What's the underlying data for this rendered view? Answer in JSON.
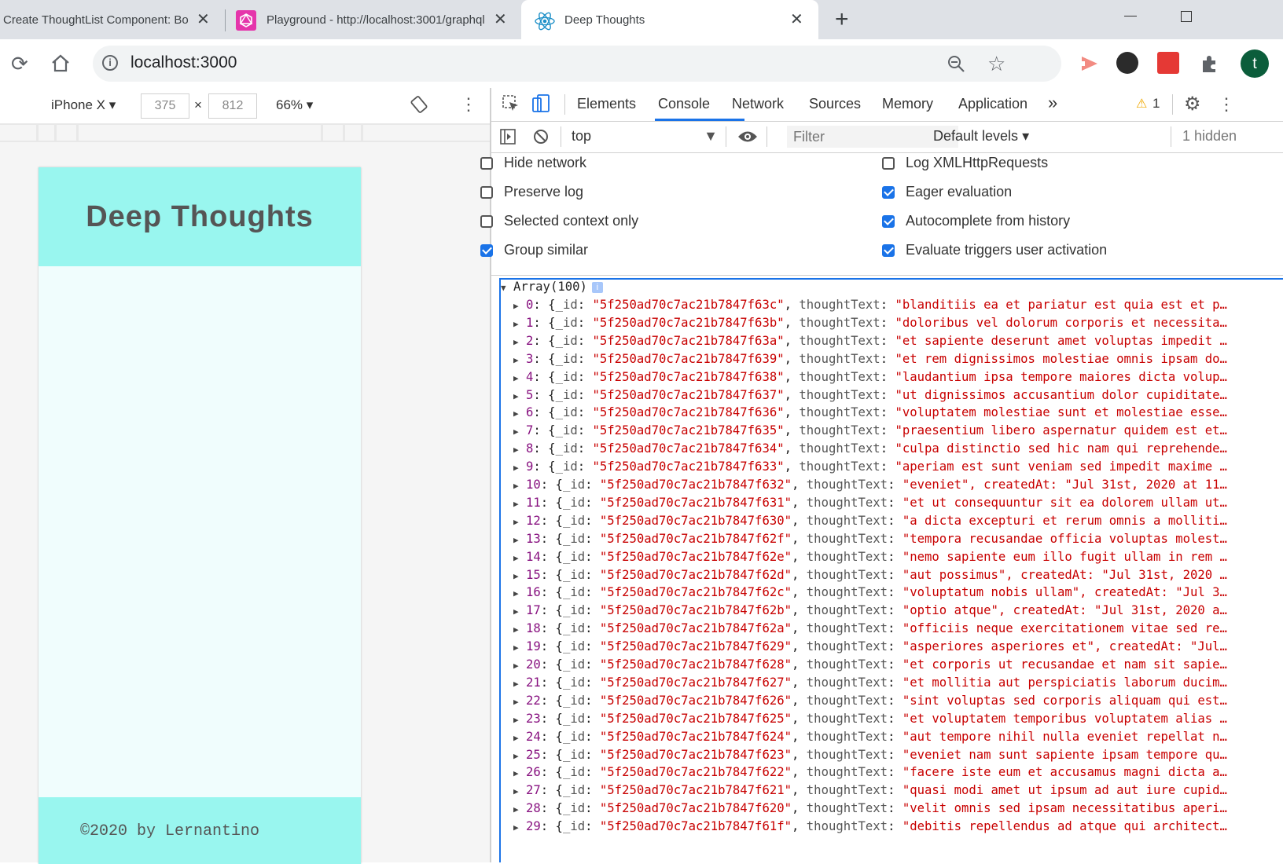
{
  "browser": {
    "tabs": [
      {
        "title": "Create ThoughtList Component: Boot",
        "favicon": "page-icon"
      },
      {
        "title": "Playground - http://localhost:3001/graphql",
        "favicon": "graphql-icon"
      },
      {
        "title": "Deep Thoughts",
        "favicon": "react-icon"
      }
    ],
    "address": "localhost:3000",
    "profile_initial": "t"
  },
  "device_toolbar": {
    "device": "iPhone X",
    "width": "375",
    "height": "812",
    "times": "×",
    "zoom": "66%"
  },
  "app": {
    "title": "Deep Thoughts",
    "footer": "©2020 by Lernantino",
    "header_color": "#99f6ef"
  },
  "devtools": {
    "tabs": [
      "Elements",
      "Console",
      "Network",
      "Sources",
      "Memory",
      "Application"
    ],
    "active_tab": "Console",
    "more": "»",
    "warnings": "1",
    "context": "top",
    "filter_placeholder": "Filter",
    "levels": "Default levels",
    "hidden": "1 hidden",
    "settings": {
      "left": [
        {
          "label": "Hide network",
          "checked": false
        },
        {
          "label": "Preserve log",
          "checked": false
        },
        {
          "label": "Selected context only",
          "checked": false
        },
        {
          "label": "Group similar",
          "checked": true
        }
      ],
      "right": [
        {
          "label": "Log XMLHttpRequests",
          "checked": false
        },
        {
          "label": "Eager evaluation",
          "checked": true
        },
        {
          "label": "Autocomplete from history",
          "checked": true
        },
        {
          "label": "Evaluate triggers user activation",
          "checked": true
        }
      ]
    },
    "accent": "#1a73e8"
  },
  "console": {
    "array_label": "Array(100)",
    "info_badge": "i",
    "rows": [
      {
        "idx": "0",
        "id": "5f250ad70c7ac21b7847f63c",
        "text": "\"blanditiis ea et pariatur est quia est et p…"
      },
      {
        "idx": "1",
        "id": "5f250ad70c7ac21b7847f63b",
        "text": "\"doloribus vel dolorum corporis et necessita…"
      },
      {
        "idx": "2",
        "id": "5f250ad70c7ac21b7847f63a",
        "text": "\"et sapiente deserunt amet voluptas impedit …"
      },
      {
        "idx": "3",
        "id": "5f250ad70c7ac21b7847f639",
        "text": "\"et rem dignissimos molestiae omnis ipsam do…"
      },
      {
        "idx": "4",
        "id": "5f250ad70c7ac21b7847f638",
        "text": "\"laudantium ipsa tempore maiores dicta volup…"
      },
      {
        "idx": "5",
        "id": "5f250ad70c7ac21b7847f637",
        "text": "\"ut dignissimos accusantium dolor cupiditate…"
      },
      {
        "idx": "6",
        "id": "5f250ad70c7ac21b7847f636",
        "text": "\"voluptatem molestiae sunt et molestiae esse…"
      },
      {
        "idx": "7",
        "id": "5f250ad70c7ac21b7847f635",
        "text": "\"praesentium libero aspernatur quidem est et…"
      },
      {
        "idx": "8",
        "id": "5f250ad70c7ac21b7847f634",
        "text": "\"culpa distinctio sed hic nam qui reprehende…"
      },
      {
        "idx": "9",
        "id": "5f250ad70c7ac21b7847f633",
        "text": "\"aperiam est sunt veniam sed impedit maxime …"
      },
      {
        "idx": "10",
        "id": "5f250ad70c7ac21b7847f632",
        "text": "\"eveniet\", createdAt: \"Jul 31st, 2020 at 11…"
      },
      {
        "idx": "11",
        "id": "5f250ad70c7ac21b7847f631",
        "text": "\"et ut consequuntur sit ea dolorem ullam ut…"
      },
      {
        "idx": "12",
        "id": "5f250ad70c7ac21b7847f630",
        "text": "\"a dicta excepturi et rerum omnis a molliti…"
      },
      {
        "idx": "13",
        "id": "5f250ad70c7ac21b7847f62f",
        "text": "\"tempora recusandae officia voluptas molest…"
      },
      {
        "idx": "14",
        "id": "5f250ad70c7ac21b7847f62e",
        "text": "\"nemo sapiente eum illo fugit ullam in rem …"
      },
      {
        "idx": "15",
        "id": "5f250ad70c7ac21b7847f62d",
        "text": "\"aut possimus\", createdAt: \"Jul 31st, 2020 …"
      },
      {
        "idx": "16",
        "id": "5f250ad70c7ac21b7847f62c",
        "text": "\"voluptatum nobis ullam\", createdAt: \"Jul 3…"
      },
      {
        "idx": "17",
        "id": "5f250ad70c7ac21b7847f62b",
        "text": "\"optio atque\", createdAt: \"Jul 31st, 2020 a…"
      },
      {
        "idx": "18",
        "id": "5f250ad70c7ac21b7847f62a",
        "text": "\"officiis neque exercitationem vitae sed re…"
      },
      {
        "idx": "19",
        "id": "5f250ad70c7ac21b7847f629",
        "text": "\"asperiores asperiores et\", createdAt: \"Jul…"
      },
      {
        "idx": "20",
        "id": "5f250ad70c7ac21b7847f628",
        "text": "\"et corporis ut recusandae et nam sit sapie…"
      },
      {
        "idx": "21",
        "id": "5f250ad70c7ac21b7847f627",
        "text": "\"et mollitia aut perspiciatis laborum ducim…"
      },
      {
        "idx": "22",
        "id": "5f250ad70c7ac21b7847f626",
        "text": "\"sint voluptas sed corporis aliquam qui est…"
      },
      {
        "idx": "23",
        "id": "5f250ad70c7ac21b7847f625",
        "text": "\"et voluptatem temporibus voluptatem alias …"
      },
      {
        "idx": "24",
        "id": "5f250ad70c7ac21b7847f624",
        "text": "\"aut tempore nihil nulla eveniet repellat n…"
      },
      {
        "idx": "25",
        "id": "5f250ad70c7ac21b7847f623",
        "text": "\"eveniet nam sunt sapiente ipsam tempore qu…"
      },
      {
        "idx": "26",
        "id": "5f250ad70c7ac21b7847f622",
        "text": "\"facere iste eum et accusamus magni dicta a…"
      },
      {
        "idx": "27",
        "id": "5f250ad70c7ac21b7847f621",
        "text": "\"quasi modi amet ut ipsum ad aut iure cupid…"
      },
      {
        "idx": "28",
        "id": "5f250ad70c7ac21b7847f620",
        "text": "\"velit omnis sed ipsam necessitatibus aperi…"
      },
      {
        "idx": "29",
        "id": "5f250ad70c7ac21b7847f61f",
        "text": "\"debitis repellendus ad atque qui architect…"
      }
    ]
  }
}
